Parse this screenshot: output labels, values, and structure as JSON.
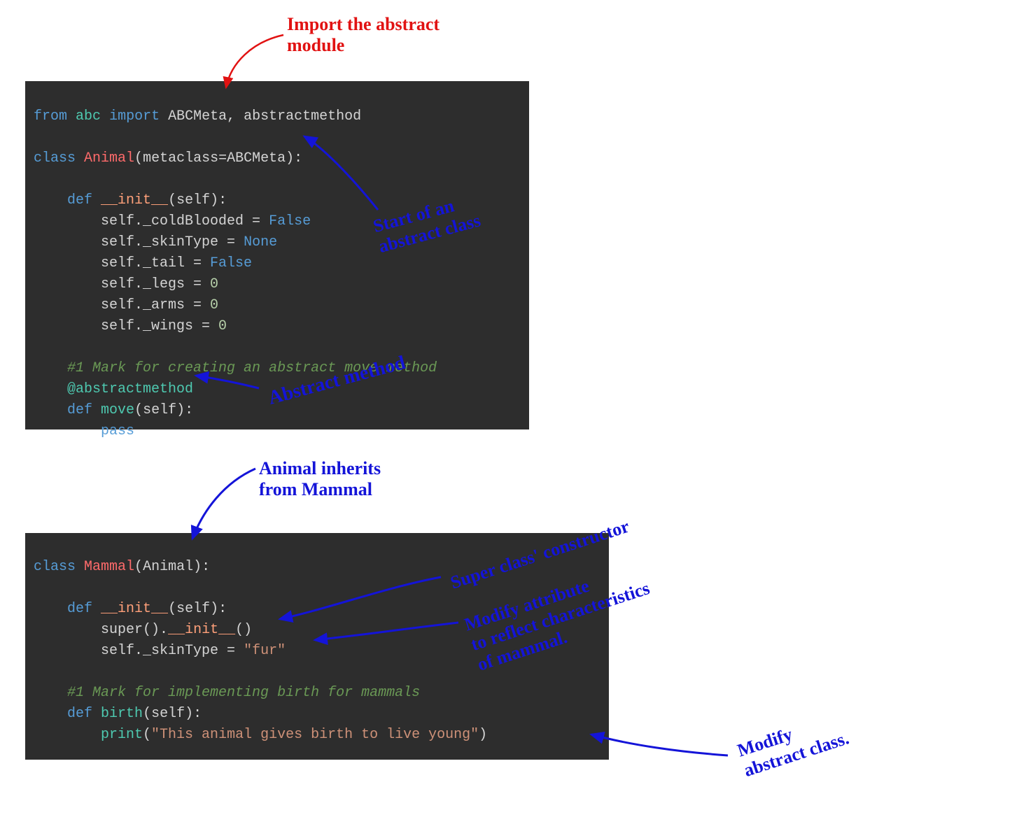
{
  "annotations": {
    "import_abstract": "Import the abstract\nmodule",
    "start_abstract": "Start of an\nabstract class",
    "abstract_method": "Abstract method",
    "animal_inherits": "Animal inherits\nfrom Mammal",
    "super_constructor": "Super class' constructor",
    "modify_attr": "Modify attribute\nto reflect characteristics\nof mammal.",
    "modify_abstract": "Modify\nabstract class."
  },
  "code1": {
    "from": "from",
    "abc": "abc",
    "import": "import",
    "abcmeta": "ABCMeta",
    "comma": ", ",
    "abstractmethod": "abstractmethod",
    "class": "class",
    "animal": "Animal",
    "metaclass_eq": "metaclass",
    "eq": "=",
    "abcmeta2": "ABCMeta",
    "colon": ":",
    "def": "def",
    "init": "__init__",
    "self": "self",
    "l_cold": "self._coldBlooded = ",
    "false": "False",
    "l_skin": "self._skinType = ",
    "none": "None",
    "l_tail": "self._tail = ",
    "false2": "False",
    "l_legs": "self._legs = ",
    "zero": "0",
    "l_arms": "self._arms = ",
    "l_wings": "self._wings = ",
    "comment1": "#1 Mark for creating an abstract move method",
    "deco": "@abstractmethod",
    "move": "move",
    "pass": "pass"
  },
  "code2": {
    "class": "class",
    "mammal": "Mammal",
    "animal": "Animal",
    "def": "def",
    "init": "__init__",
    "self": "self",
    "super": "super",
    "dot": ".",
    "init2": "__init__",
    "skinline": "self._skinType = ",
    "fur": "\"fur\"",
    "comment1": "#1 Mark for implementing birth for mammals",
    "birth": "birth",
    "print": "print",
    "msg": "\"This animal gives birth to live young\""
  }
}
